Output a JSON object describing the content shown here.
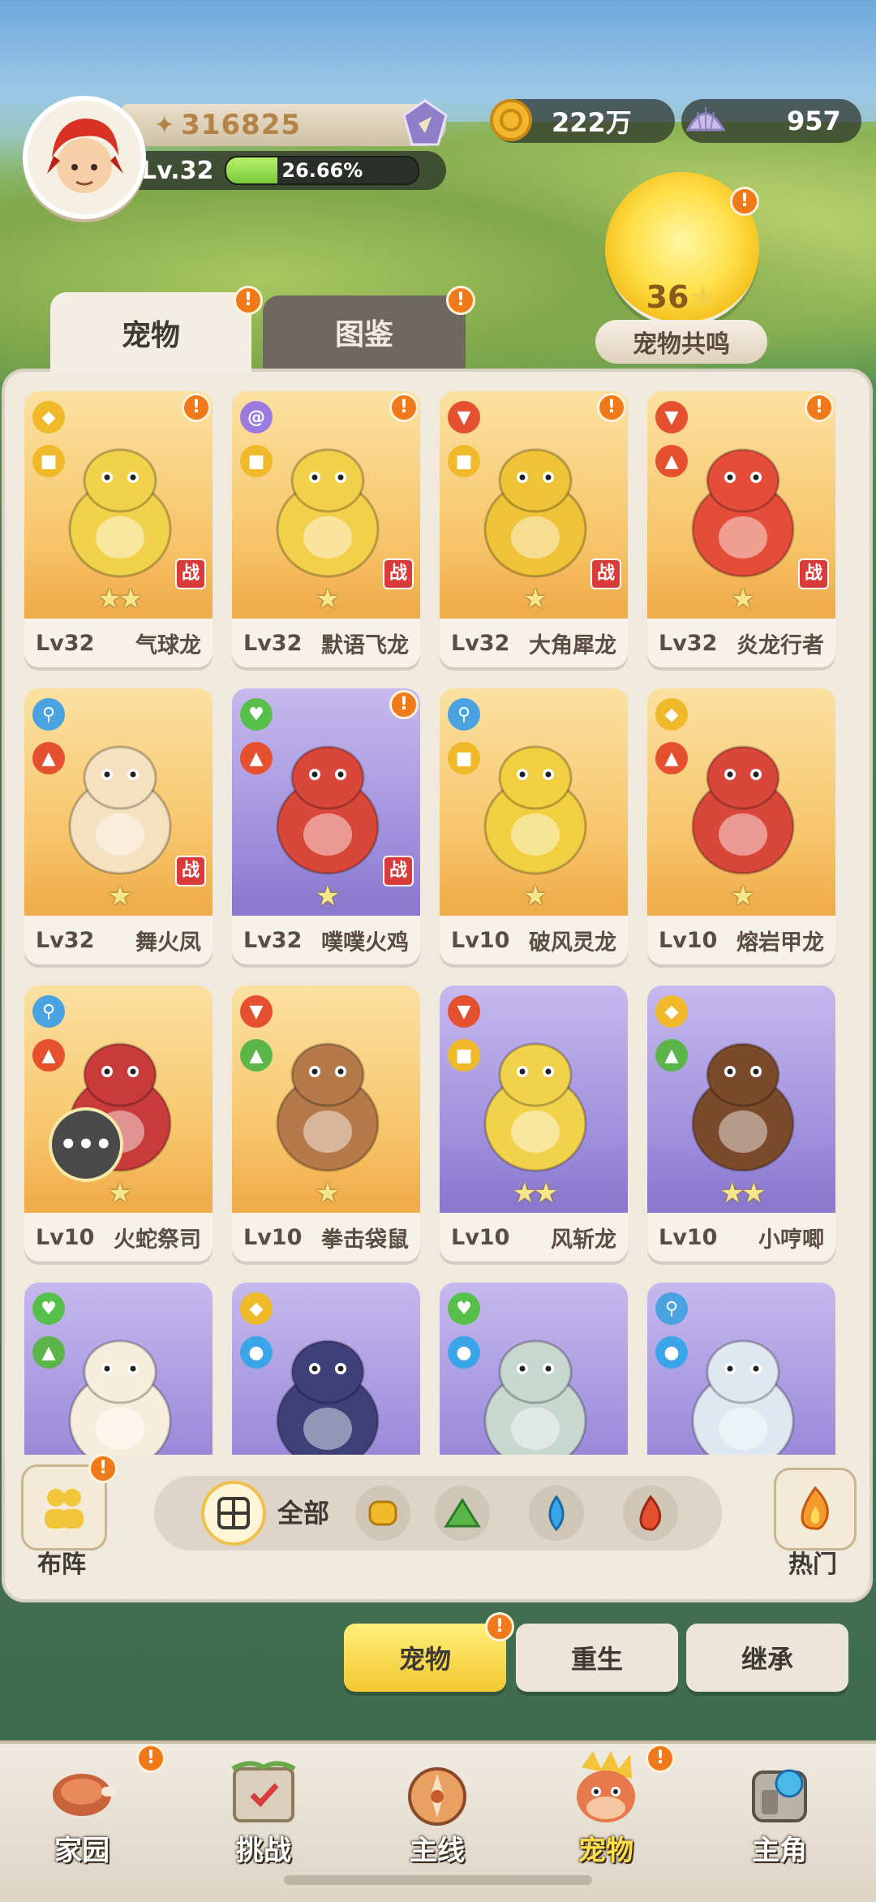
{
  "player": {
    "power": "316825",
    "level_label": "Lv.32",
    "exp_percent_text": "26.66%",
    "exp_fraction": 0.2666
  },
  "currency": {
    "gold": "222万",
    "gems": "957"
  },
  "resonance": {
    "count": "36",
    "label": "宠物共鸣"
  },
  "tabs": {
    "pets": "宠物",
    "codex": "图鉴"
  },
  "pets": [
    {
      "level": "Lv32",
      "name": "气球龙",
      "theme": "orange",
      "stars": "★★",
      "battle": true,
      "alert": true,
      "elements": [
        "shield",
        "fist"
      ]
    },
    {
      "level": "Lv32",
      "name": "默语飞龙",
      "theme": "orange",
      "stars": "★",
      "battle": true,
      "alert": true,
      "elements": [
        "spiral",
        "fist"
      ]
    },
    {
      "level": "Lv32",
      "name": "大角犀龙",
      "theme": "orange",
      "stars": "★",
      "battle": true,
      "alert": true,
      "elements": [
        "axe",
        "fist"
      ]
    },
    {
      "level": "Lv32",
      "name": "炎龙行者",
      "theme": "orange",
      "stars": "★",
      "battle": true,
      "alert": true,
      "elements": [
        "axe",
        "fire"
      ]
    },
    {
      "level": "Lv32",
      "name": "舞火凤",
      "theme": "orange",
      "stars": "★",
      "battle": true,
      "alert": false,
      "elements": [
        "key",
        "fire"
      ]
    },
    {
      "level": "Lv32",
      "name": "噗噗火鸡",
      "theme": "purple",
      "stars": "★",
      "battle": true,
      "alert": true,
      "elements": [
        "heart",
        "fire"
      ]
    },
    {
      "level": "Lv10",
      "name": "破风灵龙",
      "theme": "orange",
      "stars": "★",
      "battle": false,
      "alert": false,
      "elements": [
        "key",
        "fist"
      ]
    },
    {
      "level": "Lv10",
      "name": "熔岩甲龙",
      "theme": "orange",
      "stars": "★",
      "battle": false,
      "alert": false,
      "elements": [
        "shield",
        "fire"
      ]
    },
    {
      "level": "Lv10",
      "name": "火蛇祭司",
      "theme": "orange",
      "stars": "★",
      "battle": false,
      "alert": false,
      "elements": [
        "key",
        "fire"
      ]
    },
    {
      "level": "Lv10",
      "name": "拳击袋鼠",
      "theme": "orange",
      "stars": "★",
      "battle": false,
      "alert": false,
      "elements": [
        "axe",
        "earth"
      ]
    },
    {
      "level": "Lv10",
      "name": "风斩龙",
      "theme": "purple",
      "stars": "★★",
      "battle": false,
      "alert": false,
      "elements": [
        "axe",
        "fist"
      ]
    },
    {
      "level": "Lv10",
      "name": "小哼唧",
      "theme": "purple",
      "stars": "★★",
      "battle": false,
      "alert": false,
      "elements": [
        "shield",
        "earth"
      ]
    },
    {
      "level": "",
      "name": "",
      "theme": "purple",
      "stars": "",
      "battle": false,
      "alert": false,
      "elements": [
        "heart",
        "earth"
      ]
    },
    {
      "level": "",
      "name": "",
      "theme": "purple",
      "stars": "",
      "battle": false,
      "alert": false,
      "elements": [
        "shield",
        "water"
      ]
    },
    {
      "level": "",
      "name": "",
      "theme": "purple",
      "stars": "",
      "battle": false,
      "alert": false,
      "elements": [
        "heart",
        "water"
      ]
    },
    {
      "level": "",
      "name": "",
      "theme": "purple",
      "stars": "",
      "battle": false,
      "alert": false,
      "elements": [
        "key",
        "water"
      ]
    }
  ],
  "battle_mark": "战",
  "filters": {
    "formation": "布阵",
    "all": "全部",
    "hot": "热门"
  },
  "subtabs": {
    "pets": "宠物",
    "rebirth": "重生",
    "inherit": "继承"
  },
  "nav": {
    "home": "家园",
    "challenge": "挑战",
    "main": "主线",
    "pets": "宠物",
    "hero": "主角"
  },
  "colors": {
    "accent_orange": "#f07a1a",
    "element_fist": "#f0b92a",
    "element_fire": "#e5502e",
    "element_water": "#3aa5e8",
    "element_earth": "#5bb548",
    "element_key": "#4aa3e0",
    "element_heart": "#57c04a"
  }
}
